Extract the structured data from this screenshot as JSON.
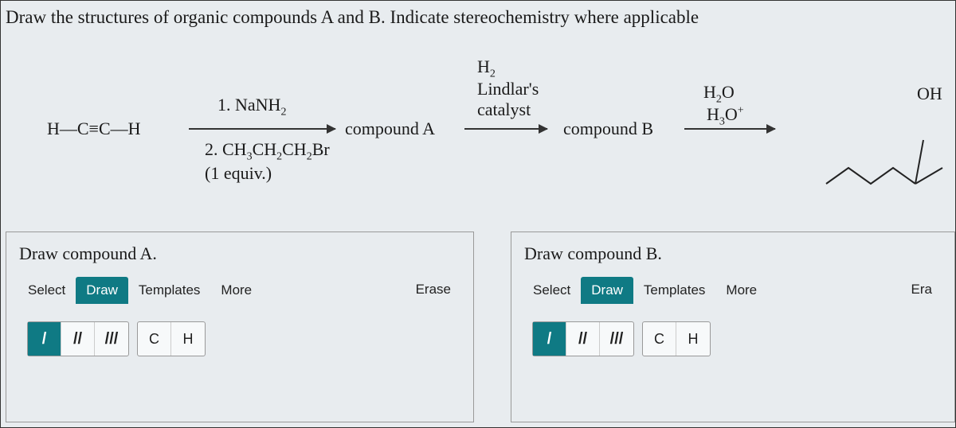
{
  "prompt": "Draw the structures of organic compounds A and B. Indicate stereochemistry where applicable",
  "scheme": {
    "start": "H—C≡C—H",
    "reagent1_line1": "1. NaNH",
    "reagent1_sub": "2",
    "reagent1_line2a": "2. CH",
    "reagent1_line2b": "CH",
    "reagent1_line2c": "CH",
    "reagent1_line2d": "Br",
    "reagent1_sub3": "3",
    "reagent1_sub2a": "2",
    "reagent1_sub2b": "2",
    "reagent1_line3": "(1 equiv.)",
    "compoundA": "compound A",
    "step2_line1": "H",
    "step2_sub": "2",
    "step2_line2": "Lindlar's",
    "step2_line3": "catalyst",
    "compoundB": "compound B",
    "step3_line1": "H",
    "step3_sub1": "2",
    "step3_line1b": "O",
    "step3_line2": "H",
    "step3_sub2": "3",
    "step3_line2b": "O",
    "step3_sup": "+",
    "product_label": "OH"
  },
  "panelA": {
    "title": "Draw compound A.",
    "tabs": [
      "Select",
      "Draw",
      "Templates",
      "More"
    ],
    "active_tab": "Draw",
    "erase": "Erase",
    "bond_single": "/",
    "bond_double": "//",
    "bond_triple": "///",
    "atom_c": "C",
    "atom_h": "H",
    "active_bond": "/"
  },
  "panelB": {
    "title": "Draw compound B.",
    "tabs": [
      "Select",
      "Draw",
      "Templates",
      "More"
    ],
    "active_tab": "Draw",
    "erase_partial": "Era",
    "bond_single": "/",
    "bond_double": "//",
    "bond_triple": "///",
    "atom_c": "C",
    "atom_h": "H",
    "active_bond": "/"
  }
}
